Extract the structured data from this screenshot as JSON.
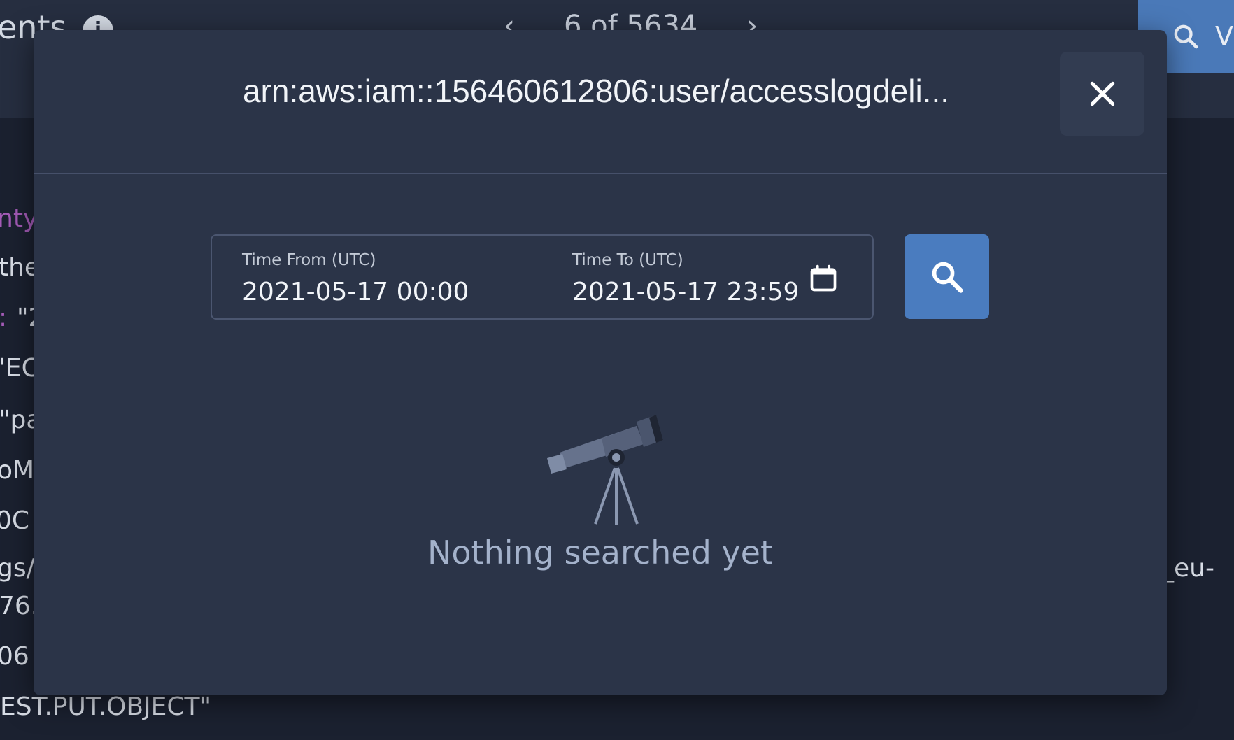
{
  "background": {
    "title_fragment": "ents",
    "info_icon": "i",
    "pager": {
      "prev": "‹",
      "text": "6 of 5634",
      "next": "›"
    },
    "search_button_fragment": "V",
    "code_lines": [
      "nty",
      "the",
      ": ",
      "\"2",
      "'EC",
      "\"pa",
      "oM",
      "0C",
      "gs/",
      "76.",
      "06",
      "EST.PUT.OBJECT\"",
      "_eu-"
    ]
  },
  "modal": {
    "title": "arn:aws:iam::156460612806:user/accesslogdeli...",
    "close_icon": "close-icon",
    "time_from": {
      "label": "Time From (UTC)",
      "value": "2021-05-17 00:00"
    },
    "time_to": {
      "label": "Time To (UTC)",
      "value": "2021-05-17 23:59"
    },
    "calendar_icon": "calendar-icon",
    "search_icon": "search-icon",
    "empty_state": {
      "illustration": "telescope-icon",
      "message": "Nothing searched yet"
    }
  },
  "colors": {
    "page_background": "#1b2130",
    "modal_background": "#2b3448",
    "accent": "#4a7cbf",
    "muted_text": "#a4b2cb",
    "syntax_key": "#a45bb7"
  }
}
